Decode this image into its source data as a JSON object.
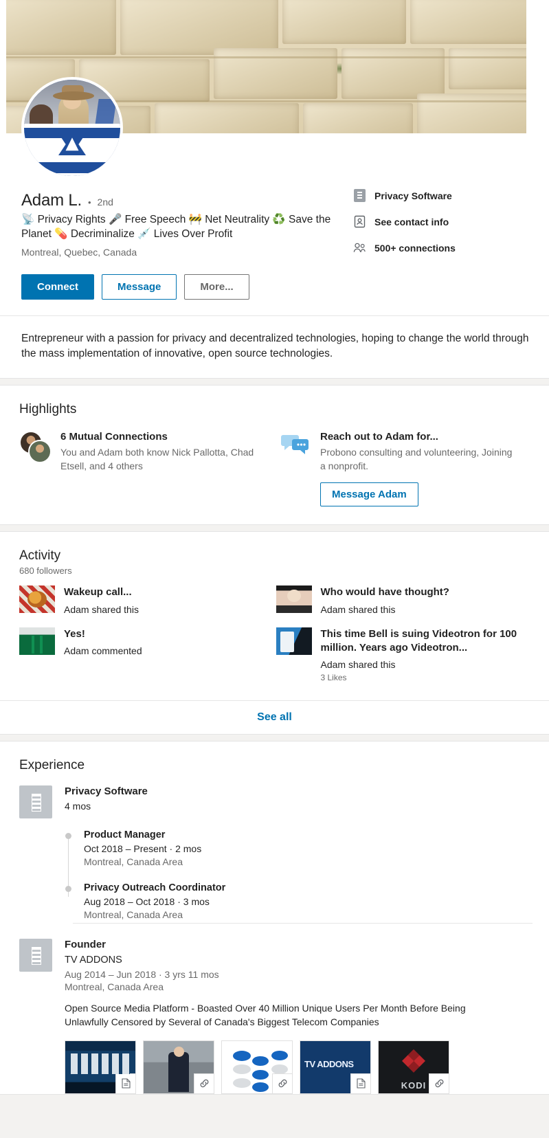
{
  "profile": {
    "name": "Adam L.",
    "separator": "•",
    "degree": "2nd",
    "headline": "📡 Privacy Rights 🎤 Free Speech 🚧 Net Neutrality ♻️ Save the Planet 💊 Decriminalize 💉 Lives Over Profit",
    "location": "Montreal, Quebec, Canada",
    "summary": "Entrepreneur with a passion for privacy and decentralized technologies, hoping to change the world through the mass implementation of innovative, open source technologies.",
    "actions": {
      "connect": "Connect",
      "message": "Message",
      "more": "More..."
    },
    "meta": [
      {
        "icon": "company-icon",
        "label": "Privacy Software"
      },
      {
        "icon": "contact-card-icon",
        "label": "See contact info"
      },
      {
        "icon": "connections-icon",
        "label": "500+ connections"
      }
    ]
  },
  "highlights": {
    "title": "Highlights",
    "mutual": {
      "title": "6 Mutual Connections",
      "description": "You and Adam both know Nick Pallotta, Chad Etsell, and 4 others"
    },
    "reach_out": {
      "title": "Reach out to Adam for...",
      "description": "Probono consulting and volunteering, Joining a nonprofit.",
      "button": "Message Adam"
    }
  },
  "activity": {
    "title": "Activity",
    "followers": "680 followers",
    "see_all": "See all",
    "items": [
      {
        "thumb": "tn-food",
        "title": "Wakeup call...",
        "subtitle": "Adam shared this",
        "likes": ""
      },
      {
        "thumb": "tn-person",
        "title": "Who would have thought?",
        "subtitle": "Adam shared this",
        "likes": ""
      },
      {
        "thumb": "tn-beer",
        "title": "Yes!",
        "subtitle": "Adam commented",
        "likes": ""
      },
      {
        "thumb": "tn-phone",
        "title": "This time Bell is suing Videotron for 100 million. Years ago Videotron...",
        "subtitle": "Adam shared this",
        "likes": "3 Likes"
      }
    ]
  },
  "experience": {
    "title": "Experience",
    "company": {
      "name": "Privacy Software",
      "duration": "4 mos",
      "roles": [
        {
          "title": "Product Manager",
          "dates": "Oct 2018 – Present · 2 mos",
          "location": "Montreal, Canada Area"
        },
        {
          "title": "Privacy Outreach Coordinator",
          "dates": "Aug 2018 – Oct 2018 · 3 mos",
          "location": "Montreal, Canada Area"
        }
      ]
    },
    "entry": {
      "title": "Founder",
      "company": "TV ADDONS",
      "dates": "Aug 2014 – Jun 2018 · 3 yrs 11 mos",
      "location": "Montreal, Canada Area",
      "description": "Open Source Media Platform - Boasted Over 40 Million Unique Users Per Month Before Being Unlawfully Censored by Several of Canada's Biggest Telecom Companies",
      "media": [
        {
          "class": "m1",
          "badge": "document-icon"
        },
        {
          "class": "m2",
          "badge": "link-icon"
        },
        {
          "class": "m3",
          "badge": "link-icon"
        },
        {
          "class": "m4",
          "badge": "document-icon"
        },
        {
          "class": "m5",
          "badge": "link-icon"
        }
      ]
    }
  },
  "colors": {
    "accent": "#0073b1",
    "page_bg": "#f3f2f0",
    "card_bg": "#ffffff"
  }
}
